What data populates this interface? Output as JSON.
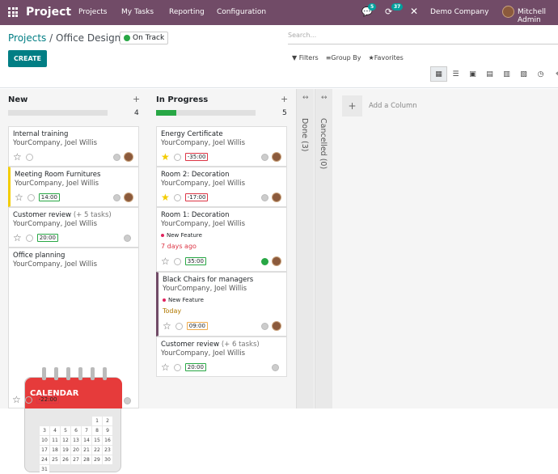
{
  "topbar": {
    "app_name": "Project",
    "menus": [
      "Projects",
      "My Tasks",
      "Reporting",
      "Configuration"
    ],
    "messages_count": "5",
    "activities_count": "37",
    "company": "Demo Company",
    "user": "Mitchell Admin"
  },
  "control": {
    "breadcrumb_root": "Projects",
    "breadcrumb_sep": "/",
    "breadcrumb_current": "Office Design",
    "status": "On Track",
    "search_placeholder": "Search...",
    "create_label": "CREATE",
    "filters_label": "Filters",
    "groupby_label": "Group By",
    "favorites_label": "Favorites"
  },
  "views": [
    "kanban",
    "list",
    "calendar",
    "pivot",
    "graph",
    "gantt",
    "activity",
    "map"
  ],
  "columns": [
    {
      "name": "New",
      "count": "4",
      "progress": 0
    },
    {
      "name": "In Progress",
      "count": "5",
      "progress": 0.2
    }
  ],
  "folded": [
    {
      "name": "Done (3)"
    },
    {
      "name": "Cancelled (0)"
    }
  ],
  "add_column": "Add a Column",
  "new_cards": [
    {
      "title": "Internal training",
      "sub": "",
      "customer": "YourCompany, Joel Willis",
      "starred": false,
      "hours": ""
    },
    {
      "title": "Meeting Room Furnitures",
      "sub": "",
      "customer": "YourCompany, Joel Willis",
      "starred": false,
      "hours": "14:00"
    },
    {
      "title": "Customer review",
      "sub": "(+ 5 tasks)",
      "customer": "YourCompany, Joel Willis",
      "starred": false,
      "hours": "20:00"
    },
    {
      "title": "Office planning",
      "sub": "",
      "customer": "YourCompany, Joel Willis",
      "starred": false,
      "hours": "-22:00"
    }
  ],
  "calendar_image": {
    "label": "CALENDAR",
    "days": [
      "",
      "",
      "",
      "",
      "",
      "1",
      "2",
      "3",
      "4",
      "5",
      "6",
      "7",
      "8",
      "9",
      "10",
      "11",
      "12",
      "13",
      "14",
      "15",
      "16",
      "17",
      "18",
      "19",
      "20",
      "21",
      "22",
      "23",
      "24",
      "25",
      "26",
      "27",
      "28",
      "29",
      "30",
      "31"
    ]
  },
  "progress_cards": [
    {
      "title": "Energy Certificate",
      "sub": "",
      "customer": "YourCompany, Joel Willis",
      "starred": true,
      "hours": "-35:00"
    },
    {
      "title": "Room 2: Decoration",
      "sub": "",
      "customer": "YourCompany, Joel Willis",
      "starred": true,
      "hours": "-17:00"
    },
    {
      "title": "Room 1: Decoration",
      "sub": "",
      "customer": "YourCompany, Joel Willis",
      "tag": "New Feature",
      "due": "7 days ago",
      "starred": false,
      "hours": "35:00"
    },
    {
      "title": "Black Chairs for managers",
      "sub": "",
      "customer": "YourCompany, Joel Willis",
      "tag": "New Feature",
      "due": "Today",
      "starred": false,
      "hours": "09:00"
    },
    {
      "title": "Customer review",
      "sub": "(+ 6 tasks)",
      "customer": "YourCompany, Joel Willis",
      "starred": false,
      "hours": "20:00"
    }
  ],
  "colors": {
    "brand": "#714b67",
    "accent": "#017e84",
    "green": "#28a745",
    "red": "#dc3545"
  }
}
